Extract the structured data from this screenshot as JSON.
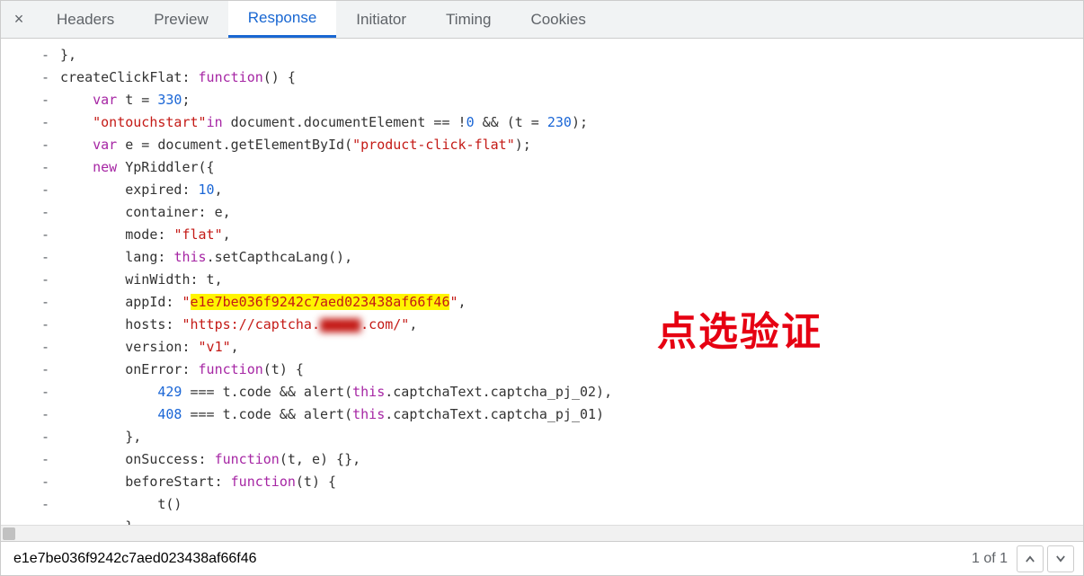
{
  "tabs": {
    "close_glyph": "×",
    "items": [
      {
        "label": "Headers",
        "active": false
      },
      {
        "label": "Preview",
        "active": false
      },
      {
        "label": "Response",
        "active": true
      },
      {
        "label": "Initiator",
        "active": false
      },
      {
        "label": "Timing",
        "active": false
      },
      {
        "label": "Cookies",
        "active": false
      }
    ]
  },
  "annotation": "点选验证",
  "code": {
    "gutter_symbol": "-",
    "lines": {
      "l0": "},",
      "l1_a": "createClickFlat: ",
      "l1_b": "function",
      "l1_c": "() {",
      "l2_a": "    ",
      "l2_b": "var",
      "l2_c": " t = ",
      "l2_d": "330",
      "l2_e": ";",
      "l3_a": "    ",
      "l3_b": "\"ontouchstart\"",
      "l3_c": "in",
      "l3_d": " document.documentElement == !",
      "l3_e": "0",
      "l3_f": " && (t = ",
      "l3_g": "230",
      "l3_h": ");",
      "l4_a": "    ",
      "l4_b": "var",
      "l4_c": " e = document.getElementById(",
      "l4_d": "\"product-click-flat\"",
      "l4_e": ");",
      "l5_a": "    ",
      "l5_b": "new",
      "l5_c": " YpRiddler({",
      "l6_a": "        expired: ",
      "l6_b": "10",
      "l6_c": ",",
      "l7": "        container: e,",
      "l8_a": "        mode: ",
      "l8_b": "\"flat\"",
      "l8_c": ",",
      "l9_a": "        lang: ",
      "l9_b": "this",
      "l9_c": ".setCapthcaLang(),",
      "l10": "        winWidth: t,",
      "l11_a": "        appId: ",
      "l11_b": "\"",
      "l11_c": "e1e7be036f9242c7aed023438af66f46",
      "l11_d": "\"",
      "l11_e": ",",
      "l12_a": "        hosts: ",
      "l12_b": "\"https://captcha.",
      "l12_c": "▇▇▇▇▇",
      "l12_d": ".com/\"",
      "l12_e": ",",
      "l13_a": "        version: ",
      "l13_b": "\"v1\"",
      "l13_c": ",",
      "l14_a": "        onError: ",
      "l14_b": "function",
      "l14_c": "(t) {",
      "l15_a": "            ",
      "l15_b": "429",
      "l15_c": " === t.code && alert(",
      "l15_d": "this",
      "l15_e": ".captchaText.captcha_pj_02),",
      "l16_a": "            ",
      "l16_b": "408",
      "l16_c": " === t.code && alert(",
      "l16_d": "this",
      "l16_e": ".captchaText.captcha_pj_01)",
      "l17": "        },",
      "l18_a": "        onSuccess: ",
      "l18_b": "function",
      "l18_c": "(t, e) {},",
      "l19_a": "        beforeStart: ",
      "l19_b": "function",
      "l19_c": "(t) {",
      "l20": "            t()",
      "l21": "        }"
    }
  },
  "search": {
    "value": "e1e7be036f9242c7aed023438af66f46",
    "result": "1 of 1"
  }
}
